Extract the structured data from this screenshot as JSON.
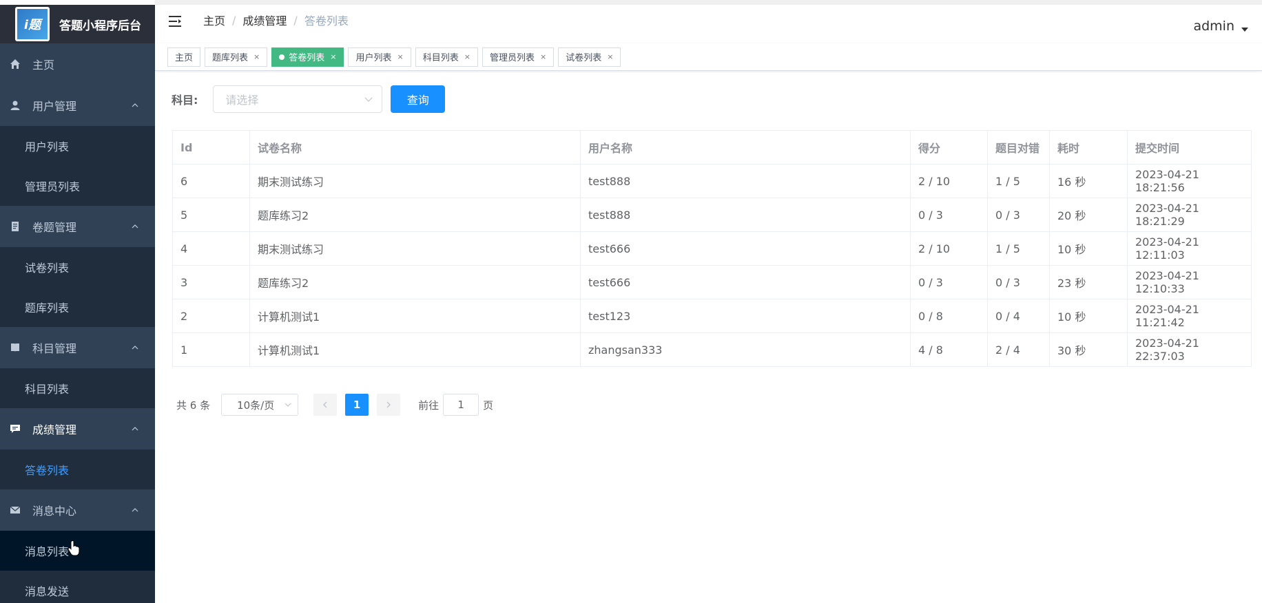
{
  "brand": {
    "title": "答题小程序后台",
    "logo_text": "i题"
  },
  "sidebar": {
    "items": [
      {
        "label": "主页",
        "icon": "home-icon"
      },
      {
        "label": "用户管理",
        "icon": "user-icon",
        "children": [
          "用户列表",
          "管理员列表"
        ]
      },
      {
        "label": "卷题管理",
        "icon": "document-icon",
        "children": [
          "试卷列表",
          "题库列表"
        ]
      },
      {
        "label": "科目管理",
        "icon": "book-icon",
        "children": [
          "科目列表"
        ]
      },
      {
        "label": "成绩管理",
        "icon": "chat-icon",
        "children": [
          "答卷列表"
        ]
      },
      {
        "label": "消息中心",
        "icon": "mail-icon",
        "children": [
          "消息列表",
          "消息发送"
        ]
      }
    ],
    "active_child": "答卷列表"
  },
  "breadcrumb": [
    "主页",
    "成绩管理",
    "答卷列表"
  ],
  "user": {
    "name": "admin"
  },
  "tags": [
    {
      "label": "主页",
      "closable": false,
      "active": false
    },
    {
      "label": "题库列表",
      "closable": true,
      "active": false
    },
    {
      "label": "答卷列表",
      "closable": true,
      "active": true
    },
    {
      "label": "用户列表",
      "closable": true,
      "active": false
    },
    {
      "label": "科目列表",
      "closable": true,
      "active": false
    },
    {
      "label": "管理员列表",
      "closable": true,
      "active": false
    },
    {
      "label": "试卷列表",
      "closable": true,
      "active": false
    }
  ],
  "filter": {
    "label": "科目:",
    "placeholder": "请选择",
    "query_label": "查询"
  },
  "table": {
    "columns": [
      "Id",
      "试卷名称",
      "用户名称",
      "得分",
      "题目对错",
      "耗时",
      "提交时间"
    ],
    "rows": [
      [
        "6",
        "期末测试练习",
        "test888",
        "2 / 10",
        "1 / 5",
        "16 秒",
        "2023-04-21 18:21:56"
      ],
      [
        "5",
        "题库练习2",
        "test888",
        "0 / 3",
        "0 / 3",
        "20 秒",
        "2023-04-21 18:21:29"
      ],
      [
        "4",
        "期末测试练习",
        "test666",
        "2 / 10",
        "1 / 5",
        "10 秒",
        "2023-04-21 12:11:03"
      ],
      [
        "3",
        "题库练习2",
        "test666",
        "0 / 3",
        "0 / 3",
        "23 秒",
        "2023-04-21 12:10:33"
      ],
      [
        "2",
        "计算机测试1",
        "test123",
        "0 / 8",
        "0 / 4",
        "10 秒",
        "2023-04-21 11:21:42"
      ],
      [
        "1",
        "计算机测试1",
        "zhangsan333",
        "4 / 8",
        "2 / 4",
        "30 秒",
        "2023-04-21 22:37:03"
      ]
    ]
  },
  "pagination": {
    "total_text": "共 6 条",
    "page_size": "10条/页",
    "current_page": "1",
    "goto_prefix": "前往",
    "goto_value": "1",
    "goto_suffix": "页"
  }
}
